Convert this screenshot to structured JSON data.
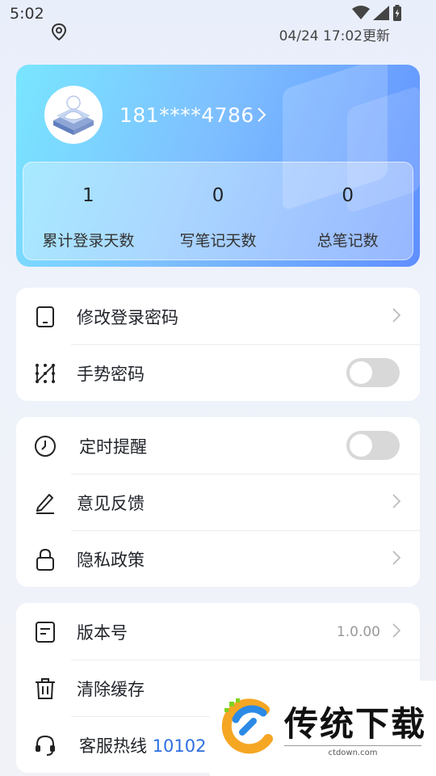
{
  "status_bar": {
    "time": "5:02",
    "update_time": "04/24 17:02更新"
  },
  "profile": {
    "phone": "181****4786",
    "stats": [
      {
        "value": "1",
        "label": "累计登录天数"
      },
      {
        "value": "0",
        "label": "写笔记天数"
      },
      {
        "value": "0",
        "label": "总笔记数"
      }
    ]
  },
  "group1": {
    "change_password": "修改登录密码",
    "gesture_password": "手势密码",
    "gesture_enabled": false
  },
  "group2": {
    "timed_reminder": "定时提醒",
    "reminder_enabled": false,
    "feedback": "意见反馈",
    "privacy_policy": "隐私政策"
  },
  "group3": {
    "version_label": "版本号",
    "version_value": "1.0.00",
    "clear_cache": "清除缓存",
    "hotline_label": "客服热线",
    "hotline_number": "10102"
  },
  "watermark": {
    "brand": "传统下载",
    "url": "ctdown.com"
  },
  "colors": {
    "accent": "#2d6fe0",
    "card_gradient_start": "#79e6ff",
    "card_gradient_end": "#5f8fff"
  }
}
